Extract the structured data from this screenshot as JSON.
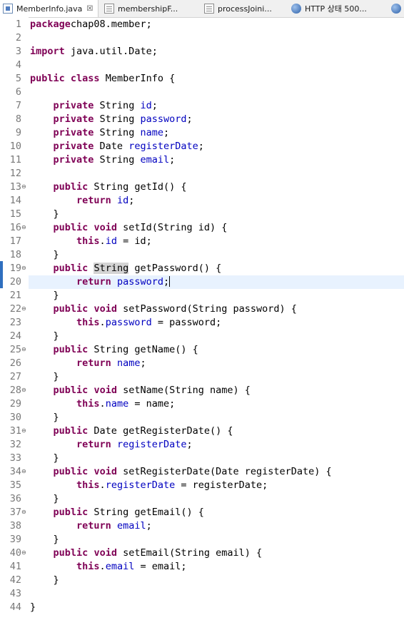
{
  "tabs": [
    {
      "label": "MemberInfo.java",
      "icon": "java-file-icon",
      "active": true,
      "close": "☒"
    },
    {
      "label": "membershipF...",
      "icon": "jsp-file-icon"
    },
    {
      "label": "processJoini...",
      "icon": "jsp-file-icon"
    },
    {
      "label": "HTTP 상태 500...",
      "icon": "browser-globe-icon"
    }
  ],
  "editor": {
    "current_line": 20,
    "lines": [
      {
        "n": "1",
        "tokens": [
          [
            "kw",
            "package"
          ],
          [
            "",
            "chap08.member;"
          ]
        ]
      },
      {
        "n": "2",
        "tokens": []
      },
      {
        "n": "3",
        "tokens": [
          [
            "kw",
            "import"
          ],
          [
            "",
            " java.util.Date;"
          ]
        ]
      },
      {
        "n": "4",
        "tokens": []
      },
      {
        "n": "5",
        "tokens": [
          [
            "kw",
            "public"
          ],
          [
            "",
            " "
          ],
          [
            "kw",
            "class"
          ],
          [
            "",
            " MemberInfo {"
          ]
        ]
      },
      {
        "n": "6",
        "tokens": []
      },
      {
        "n": "7",
        "tokens": [
          [
            "",
            "    "
          ],
          [
            "kw",
            "private"
          ],
          [
            "",
            " String "
          ],
          [
            "fld",
            "id"
          ],
          [
            "",
            ";"
          ]
        ]
      },
      {
        "n": "8",
        "tokens": [
          [
            "",
            "    "
          ],
          [
            "kw",
            "private"
          ],
          [
            "",
            " String "
          ],
          [
            "fld",
            "password"
          ],
          [
            "",
            ";"
          ]
        ]
      },
      {
        "n": "9",
        "tokens": [
          [
            "",
            "    "
          ],
          [
            "kw",
            "private"
          ],
          [
            "",
            " String "
          ],
          [
            "fld",
            "name"
          ],
          [
            "",
            ";"
          ]
        ]
      },
      {
        "n": "10",
        "tokens": [
          [
            "",
            "    "
          ],
          [
            "kw",
            "private"
          ],
          [
            "",
            " Date "
          ],
          [
            "fld",
            "registerDate"
          ],
          [
            "",
            ";"
          ]
        ]
      },
      {
        "n": "11",
        "tokens": [
          [
            "",
            "    "
          ],
          [
            "kw",
            "private"
          ],
          [
            "",
            " String "
          ],
          [
            "fld",
            "email"
          ],
          [
            "",
            ";"
          ]
        ]
      },
      {
        "n": "12",
        "tokens": []
      },
      {
        "n": "13",
        "fold": true,
        "tokens": [
          [
            "",
            "    "
          ],
          [
            "kw",
            "public"
          ],
          [
            "",
            " String getId() {"
          ]
        ]
      },
      {
        "n": "14",
        "tokens": [
          [
            "",
            "        "
          ],
          [
            "kw",
            "return"
          ],
          [
            "",
            " "
          ],
          [
            "fld",
            "id"
          ],
          [
            "",
            ";"
          ]
        ]
      },
      {
        "n": "15",
        "tokens": [
          [
            "",
            "    }"
          ]
        ]
      },
      {
        "n": "16",
        "fold": true,
        "tokens": [
          [
            "",
            "    "
          ],
          [
            "kw",
            "public"
          ],
          [
            "",
            " "
          ],
          [
            "kw",
            "void"
          ],
          [
            "",
            " setId(String id) {"
          ]
        ]
      },
      {
        "n": "17",
        "tokens": [
          [
            "",
            "        "
          ],
          [
            "kw",
            "this"
          ],
          [
            "",
            "."
          ],
          [
            "fld",
            "id"
          ],
          [
            "",
            " = id;"
          ]
        ]
      },
      {
        "n": "18",
        "tokens": [
          [
            "",
            "    }"
          ]
        ]
      },
      {
        "n": "19",
        "fold": true,
        "tokens": [
          [
            "",
            "    "
          ],
          [
            "kw",
            "public"
          ],
          [
            "",
            " "
          ],
          [
            "hl",
            "String"
          ],
          [
            "",
            " getPassword() {"
          ]
        ]
      },
      {
        "n": "20",
        "tokens": [
          [
            "",
            "        "
          ],
          [
            "kw",
            "return"
          ],
          [
            "",
            " "
          ],
          [
            "fld",
            "password"
          ],
          [
            "",
            ";"
          ],
          [
            "caret",
            ""
          ]
        ]
      },
      {
        "n": "21",
        "tokens": [
          [
            "",
            "    }"
          ]
        ]
      },
      {
        "n": "22",
        "fold": true,
        "tokens": [
          [
            "",
            "    "
          ],
          [
            "kw",
            "public"
          ],
          [
            "",
            " "
          ],
          [
            "kw",
            "void"
          ],
          [
            "",
            " setPassword(String password) {"
          ]
        ]
      },
      {
        "n": "23",
        "tokens": [
          [
            "",
            "        "
          ],
          [
            "kw",
            "this"
          ],
          [
            "",
            "."
          ],
          [
            "fld",
            "password"
          ],
          [
            "",
            " = password;"
          ]
        ]
      },
      {
        "n": "24",
        "tokens": [
          [
            "",
            "    }"
          ]
        ]
      },
      {
        "n": "25",
        "fold": true,
        "tokens": [
          [
            "",
            "    "
          ],
          [
            "kw",
            "public"
          ],
          [
            "",
            " String getName() {"
          ]
        ]
      },
      {
        "n": "26",
        "tokens": [
          [
            "",
            "        "
          ],
          [
            "kw",
            "return"
          ],
          [
            "",
            " "
          ],
          [
            "fld",
            "name"
          ],
          [
            "",
            ";"
          ]
        ]
      },
      {
        "n": "27",
        "tokens": [
          [
            "",
            "    }"
          ]
        ]
      },
      {
        "n": "28",
        "fold": true,
        "tokens": [
          [
            "",
            "    "
          ],
          [
            "kw",
            "public"
          ],
          [
            "",
            " "
          ],
          [
            "kw",
            "void"
          ],
          [
            "",
            " setName(String name) {"
          ]
        ]
      },
      {
        "n": "29",
        "tokens": [
          [
            "",
            "        "
          ],
          [
            "kw",
            "this"
          ],
          [
            "",
            "."
          ],
          [
            "fld",
            "name"
          ],
          [
            "",
            " = name;"
          ]
        ]
      },
      {
        "n": "30",
        "tokens": [
          [
            "",
            "    }"
          ]
        ]
      },
      {
        "n": "31",
        "fold": true,
        "tokens": [
          [
            "",
            "    "
          ],
          [
            "kw",
            "public"
          ],
          [
            "",
            " Date getRegisterDate() {"
          ]
        ]
      },
      {
        "n": "32",
        "tokens": [
          [
            "",
            "        "
          ],
          [
            "kw",
            "return"
          ],
          [
            "",
            " "
          ],
          [
            "fld",
            "registerDate"
          ],
          [
            "",
            ";"
          ]
        ]
      },
      {
        "n": "33",
        "tokens": [
          [
            "",
            "    }"
          ]
        ]
      },
      {
        "n": "34",
        "fold": true,
        "tokens": [
          [
            "",
            "    "
          ],
          [
            "kw",
            "public"
          ],
          [
            "",
            " "
          ],
          [
            "kw",
            "void"
          ],
          [
            "",
            " setRegisterDate(Date registerDate) {"
          ]
        ]
      },
      {
        "n": "35",
        "tokens": [
          [
            "",
            "        "
          ],
          [
            "kw",
            "this"
          ],
          [
            "",
            "."
          ],
          [
            "fld",
            "registerDate"
          ],
          [
            "",
            " = registerDate;"
          ]
        ]
      },
      {
        "n": "36",
        "tokens": [
          [
            "",
            "    }"
          ]
        ]
      },
      {
        "n": "37",
        "fold": true,
        "tokens": [
          [
            "",
            "    "
          ],
          [
            "kw",
            "public"
          ],
          [
            "",
            " String getEmail() {"
          ]
        ]
      },
      {
        "n": "38",
        "tokens": [
          [
            "",
            "        "
          ],
          [
            "kw",
            "return"
          ],
          [
            "",
            " "
          ],
          [
            "fld",
            "email"
          ],
          [
            "",
            ";"
          ]
        ]
      },
      {
        "n": "39",
        "tokens": [
          [
            "",
            "    }"
          ]
        ]
      },
      {
        "n": "40",
        "fold": true,
        "tokens": [
          [
            "",
            "    "
          ],
          [
            "kw",
            "public"
          ],
          [
            "",
            " "
          ],
          [
            "kw",
            "void"
          ],
          [
            "",
            " setEmail(String email) {"
          ]
        ]
      },
      {
        "n": "41",
        "tokens": [
          [
            "",
            "        "
          ],
          [
            "kw",
            "this"
          ],
          [
            "",
            "."
          ],
          [
            "fld",
            "email"
          ],
          [
            "",
            " = email;"
          ]
        ]
      },
      {
        "n": "42",
        "tokens": [
          [
            "",
            "    }"
          ]
        ]
      },
      {
        "n": "43",
        "tokens": []
      },
      {
        "n": "44",
        "tokens": [
          [
            "",
            "}"
          ]
        ]
      }
    ]
  }
}
